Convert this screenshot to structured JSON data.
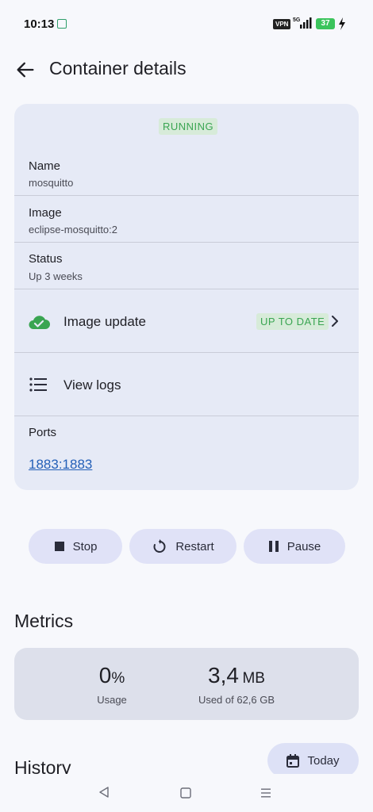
{
  "status_bar": {
    "time": "10:13",
    "vpn": "VPN",
    "network": "5G",
    "battery": "37"
  },
  "app_bar": {
    "title": "Container details"
  },
  "details": {
    "state_badge": "RUNNING",
    "name_label": "Name",
    "name_value": "mosquitto",
    "image_label": "Image",
    "image_value": "eclipse-mosquitto:2",
    "status_label": "Status",
    "status_value": "Up 3 weeks",
    "image_update_label": "Image update",
    "image_update_badge": "UP TO DATE",
    "view_logs_label": "View logs",
    "ports_label": "Ports",
    "port_value": "1883:1883"
  },
  "actions": {
    "stop": "Stop",
    "restart": "Restart",
    "pause": "Pause"
  },
  "metrics": {
    "title": "Metrics",
    "cpu_value": "0",
    "cpu_unit": "%",
    "cpu_caption": "Usage",
    "mem_value": "3,4",
    "mem_unit": "MB",
    "mem_caption": "Used of 62,6 GB"
  },
  "history": {
    "title": "History",
    "range_button": "Today"
  },
  "colors": {
    "accent_green": "#3aa552",
    "link_blue": "#2460b8",
    "card_bg": "#e6eaf6"
  }
}
